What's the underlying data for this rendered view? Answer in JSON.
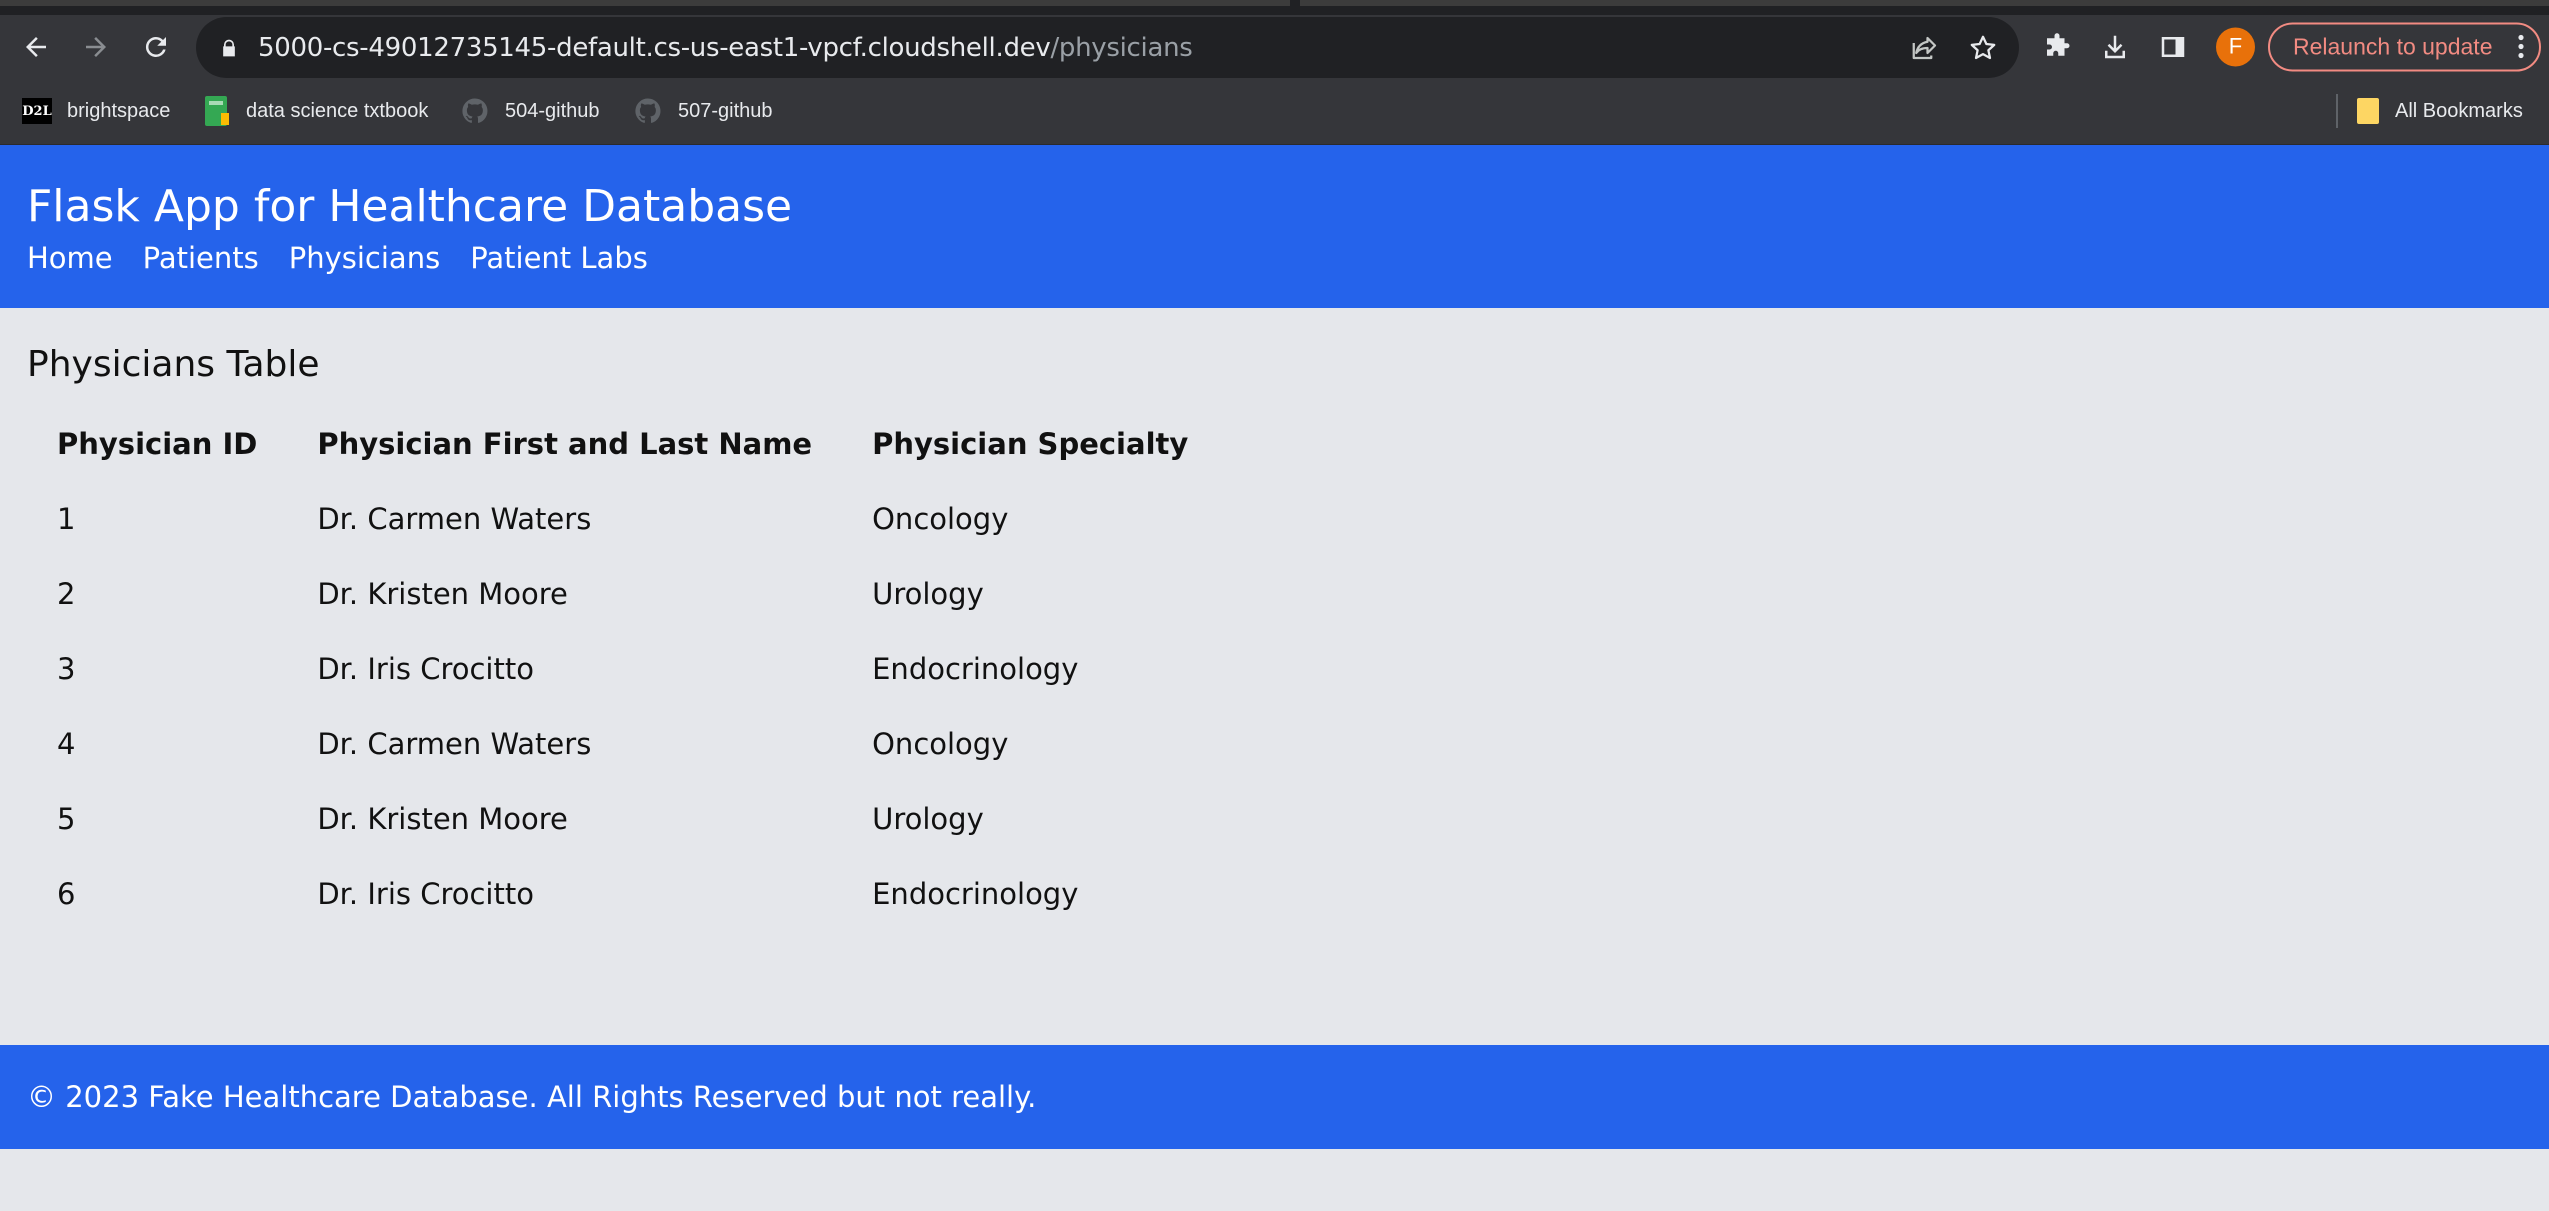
{
  "browser": {
    "url_host": "5000-cs-49012735145-default.cs-us-east1-vpcf.cloudshell.dev",
    "url_path": "/physicians",
    "avatar_letter": "F",
    "relaunch_label": "Relaunch to update",
    "bookmarks": [
      {
        "label": "brightspace",
        "icon": "d2l-icon"
      },
      {
        "label": "data science txtbook",
        "icon": "book-icon"
      },
      {
        "label": "504-github",
        "icon": "github-icon"
      },
      {
        "label": "507-github",
        "icon": "github-icon"
      }
    ],
    "all_bookmarks_label": "All Bookmarks",
    "d2l_badge": "D2L"
  },
  "site": {
    "title": "Flask App for Healthcare Database",
    "nav": [
      {
        "label": "Home"
      },
      {
        "label": "Patients"
      },
      {
        "label": "Physicians"
      },
      {
        "label": "Patient Labs"
      }
    ],
    "accent": "#2563eb"
  },
  "main": {
    "heading": "Physicians Table",
    "columns": [
      "Physician ID",
      "Physician First and Last Name",
      "Physician Specialty"
    ],
    "rows": [
      {
        "id": "1",
        "name": "Dr. Carmen Waters",
        "specialty": "Oncology"
      },
      {
        "id": "2",
        "name": "Dr. Kristen Moore",
        "specialty": "Urology"
      },
      {
        "id": "3",
        "name": "Dr. Iris Crocitto",
        "specialty": "Endocrinology"
      },
      {
        "id": "4",
        "name": "Dr. Carmen Waters",
        "specialty": "Oncology"
      },
      {
        "id": "5",
        "name": "Dr. Kristen Moore",
        "specialty": "Urology"
      },
      {
        "id": "6",
        "name": "Dr. Iris Crocitto",
        "specialty": "Endocrinology"
      }
    ]
  },
  "footer": {
    "text": "© 2023 Fake Healthcare Database. All Rights Reserved but not really."
  }
}
